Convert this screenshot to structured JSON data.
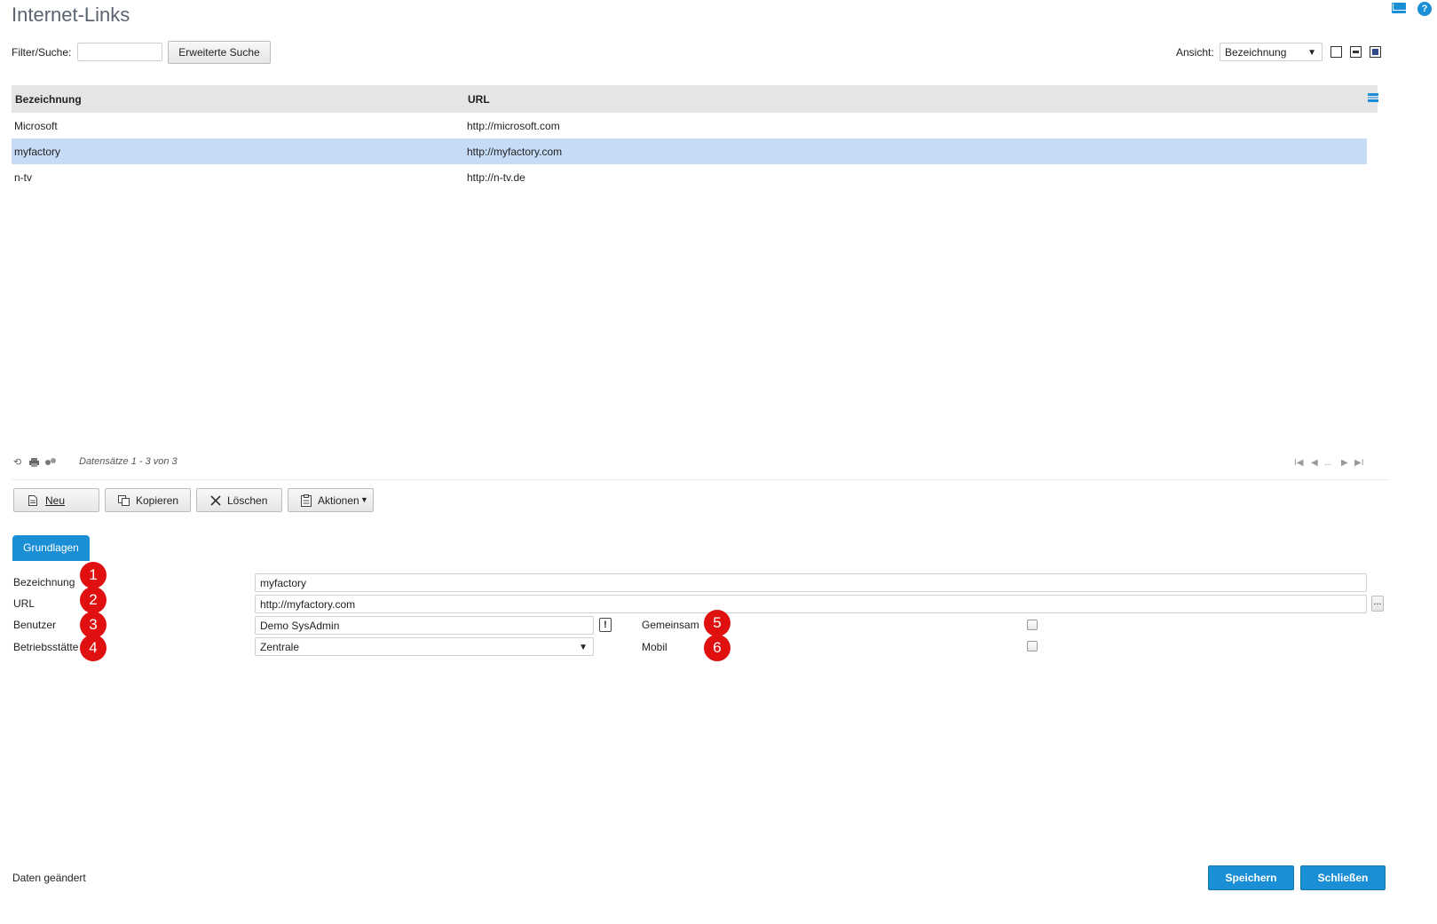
{
  "page": {
    "title": "Internet-Links"
  },
  "toolbar": {
    "filter_label": "Filter/Suche:",
    "filter_value": "",
    "advanced_search_label": "Erweiterte Suche",
    "view_label": "Ansicht:",
    "view_selected": "Bezeichnung"
  },
  "grid": {
    "columns": [
      "Bezeichnung",
      "URL"
    ],
    "rows": [
      {
        "bezeichnung": "Microsoft",
        "url": "http://microsoft.com",
        "selected": false
      },
      {
        "bezeichnung": "myfactory",
        "url": "http://myfactory.com",
        "selected": true
      },
      {
        "bezeichnung": "n-tv",
        "url": "http://n-tv.de",
        "selected": false
      }
    ],
    "status": "Datensätze 1 - 3 von 3",
    "pager_ellipsis": "..."
  },
  "actions": {
    "new_label": "Neu",
    "copy_label": "Kopieren",
    "delete_label": "Löschen",
    "actions_label": "Aktionen"
  },
  "tabs": [
    {
      "label": "Grundlagen",
      "active": true
    }
  ],
  "form": {
    "bezeichnung_label": "Bezeichnung",
    "bezeichnung_value": "myfactory",
    "url_label": "URL",
    "url_value": "http://myfactory.com",
    "url_browse_label": "...",
    "benutzer_label": "Benutzer",
    "benutzer_value": "Demo SysAdmin",
    "benutzer_info_label": "!",
    "betriebsstaette_label": "Betriebsstätte",
    "betriebsstaette_value": "Zentrale",
    "gemeinsam_label": "Gemeinsam",
    "gemeinsam_checked": false,
    "mobil_label": "Mobil",
    "mobil_checked": false
  },
  "badges": [
    "1",
    "2",
    "3",
    "4",
    "5",
    "6"
  ],
  "colors": {
    "accent": "#1a8fd6",
    "selected_row": "#c6dbf5",
    "badge": "#e11010",
    "header_bg": "#e5e5e5"
  },
  "footer": {
    "status": "Daten geändert",
    "save_label": "Speichern",
    "close_label": "Schließen"
  }
}
